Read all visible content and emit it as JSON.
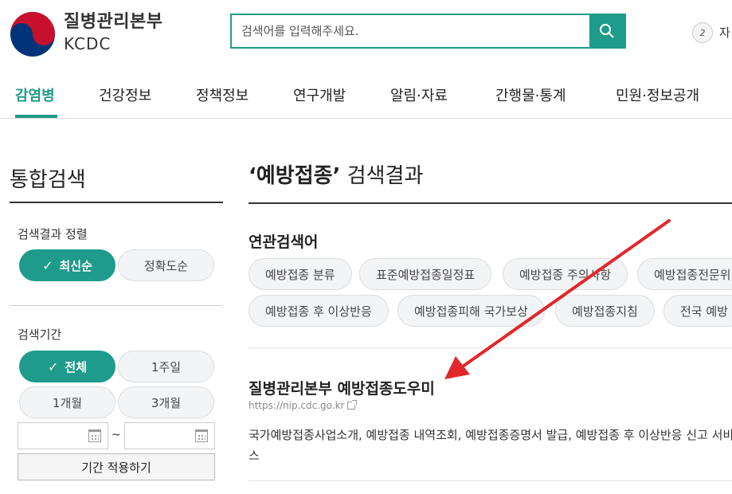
{
  "header": {
    "logo_name": "질병관리본부",
    "logo_sub": "KCDC",
    "search_placeholder": "검색어를 입력해주세요.",
    "lang_badge": "2",
    "lang_text": "자"
  },
  "nav": {
    "items": [
      "감염병",
      "건강정보",
      "정책정보",
      "연구개발",
      "알림·자료",
      "간행물·통계",
      "민원·정보공개"
    ],
    "active_index": 0
  },
  "sidebar": {
    "title": "통합검색",
    "sort_label": "검색결과 정렬",
    "sort_options": [
      "최신순",
      "정확도순"
    ],
    "sort_selected": 0,
    "period_label": "검색기간",
    "period_options": [
      "전체",
      "1주일",
      "1개월",
      "3개월"
    ],
    "period_selected": 0,
    "date_separator": "~",
    "apply_label": "기간 적용하기"
  },
  "main": {
    "query": "‘예방접종’",
    "title_suffix": " 검색결과",
    "related_label": "연관검색어",
    "related_row1": [
      "예방접종 분류",
      "표준예방접종일정표",
      "예방접종 주의사항",
      "예방접종전문위"
    ],
    "related_row2": [
      "예방접종 후 이상반응",
      "예방접종피해 국가보상",
      "예방접종지침",
      "전국 예방"
    ],
    "result": {
      "title": "질병관리본부 예방접종도우미",
      "url": "https://nip.cdc.go.kr",
      "desc": "국가예방접종사업소개, 예방접종 내역조회, 예방접종증명서 발급, 예방접종 후 이상반응 신고 서비스"
    }
  },
  "colors": {
    "accent": "#1e9b8a",
    "annotation_arrow": "#e0282c",
    "logo_red": "#c8102e",
    "logo_blue": "#003478"
  }
}
